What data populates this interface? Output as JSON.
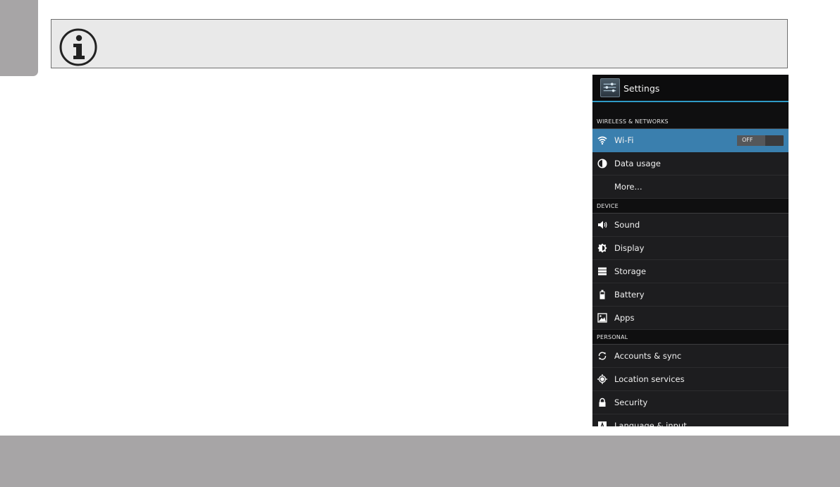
{
  "note": {
    "icon": "info-icon"
  },
  "settings": {
    "title": "Settings",
    "app_icon": "settings-sliders-icon",
    "sections": [
      {
        "header": "WIRELESS & NETWORKS"
      },
      {
        "header": "DEVICE"
      },
      {
        "header": "PERSONAL"
      }
    ],
    "items": {
      "wifi": {
        "label": "Wi-Fi",
        "icon": "wifi-icon",
        "toggle": "OFF"
      },
      "data_usage": {
        "label": "Data usage",
        "icon": "data-usage-icon"
      },
      "more": {
        "label": "More..."
      },
      "sound": {
        "label": "Sound",
        "icon": "speaker-icon"
      },
      "display": {
        "label": "Display",
        "icon": "brightness-icon"
      },
      "storage": {
        "label": "Storage",
        "icon": "storage-icon"
      },
      "battery": {
        "label": "Battery",
        "icon": "battery-icon"
      },
      "apps": {
        "label": "Apps",
        "icon": "apps-icon"
      },
      "accounts": {
        "label": "Accounts & sync",
        "icon": "sync-icon"
      },
      "location": {
        "label": "Location services",
        "icon": "location-icon"
      },
      "security": {
        "label": "Security",
        "icon": "lock-icon"
      },
      "language": {
        "label": "Language & input",
        "icon": "keyboard-icon"
      }
    },
    "accent_color": "#2f9bc6",
    "selected_color": "#3a7fae"
  }
}
